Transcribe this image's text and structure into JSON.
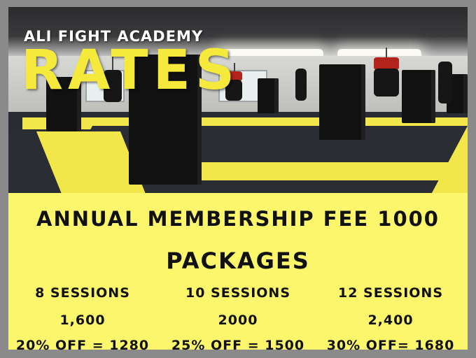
{
  "header": {
    "academy_name": "ALI FIGHT ACADEMY",
    "title": "RATES"
  },
  "membership": {
    "text": "ANNUAL MEMBERSHIP FEE 1000"
  },
  "packages": {
    "title": "PACKAGES",
    "items": [
      {
        "name": "8 SESSIONS",
        "price": "1,600",
        "discount": "20% OFF = 1280"
      },
      {
        "name": "10 SESSIONS",
        "price": "2000",
        "discount": "25% OFF = 1500"
      },
      {
        "name": "12 SESSIONS",
        "price": "2,400",
        "discount": "30% OFF= 1680"
      }
    ]
  },
  "colors": {
    "title_yellow": "#f5ea3c",
    "panel_yellow": "#fbf66c",
    "text_dark": "#111111"
  }
}
